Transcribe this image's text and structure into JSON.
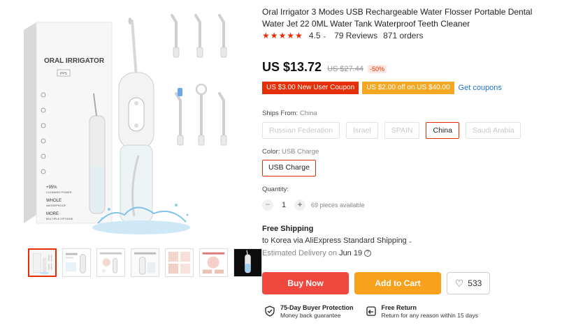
{
  "product": {
    "title": "Oral Irrigator 3 Modes USB Rechargeable Water Flosser Portable Dental Water Jet 22 0ML Water Tank Waterproof Teeth Cleaner",
    "rating": "4.5",
    "stars": 5,
    "reviews": "79 Reviews",
    "orders": "871 orders"
  },
  "gallery": {
    "box_brand": "ORAL IRRIGATOR",
    "box_badge": "PPS",
    "box_features": [
      "+95%",
      "CLEANING POWER",
      "WHOLE",
      "WATERPROOF",
      "MORE",
      "MULTIPLE OPTIONS"
    ],
    "thumb_count": 7,
    "active_thumb": 0
  },
  "price": {
    "current": "US $13.72",
    "original": "US $27.44",
    "discount": "-50%"
  },
  "coupons": {
    "new_user": "US $3.00 New User Coupon",
    "store": "US $2.00 off on US $40.00",
    "get_link": "Get coupons"
  },
  "ships_from": {
    "label": "Ships From:",
    "selected": "China",
    "options": [
      "Russian Federation",
      "Israel",
      "SPAIN",
      "China",
      "Saudi Arabia"
    ]
  },
  "color": {
    "label": "Color:",
    "selected": "USB Charge",
    "options": [
      "USB Charge"
    ]
  },
  "quantity": {
    "label": "Quantity:",
    "value": "1",
    "minus": "−",
    "plus": "+",
    "available": "69 pieces available"
  },
  "shipping": {
    "title": "Free Shipping",
    "destination": "to Korea via AliExpress Standard Shipping",
    "delivery_label": "Estimated Delivery on",
    "delivery_date": "Jun 19"
  },
  "actions": {
    "buy_now": "Buy Now",
    "add_to_cart": "Add to Cart",
    "wishlist_count": "533"
  },
  "guarantees": {
    "protection_title": "75-Day Buyer Protection",
    "protection_sub": "Money back guarantee",
    "return_title": "Free Return",
    "return_sub": "Return for any reason within 15 days"
  },
  "colors": {
    "accent": "#e62e04",
    "buy": "#f0473e",
    "cart": "#f7a11c",
    "coupon_orange": "#f5a623",
    "link": "#1a73c8"
  }
}
